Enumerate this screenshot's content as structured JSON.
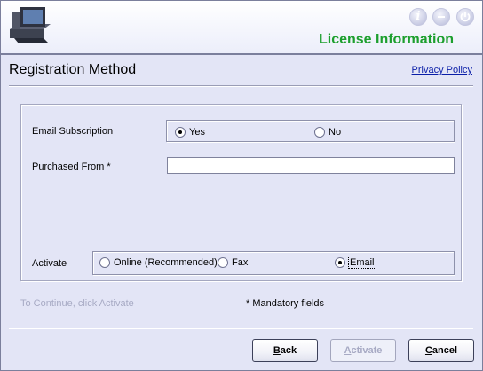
{
  "header": {
    "app_title": "License Information",
    "window_controls": [
      "info-icon",
      "minimize-icon",
      "power-icon"
    ],
    "info_glyph": "i"
  },
  "page": {
    "title": "Registration Method",
    "privacy_link": "Privacy Policy"
  },
  "form": {
    "email_subscription": {
      "label": "Email Subscription",
      "options": [
        {
          "label": "Yes",
          "checked": true
        },
        {
          "label": "No",
          "checked": false
        }
      ]
    },
    "purchased_from": {
      "label": "Purchased From *",
      "value": "",
      "placeholder": ""
    },
    "activate": {
      "label": "Activate",
      "options": [
        {
          "label": "Online (Recommended)",
          "checked": false
        },
        {
          "label": "Fax",
          "checked": false
        },
        {
          "label": "Email",
          "checked": true
        }
      ]
    }
  },
  "footer": {
    "hint": "To Continue, click Activate",
    "mandatory_note": "* Mandatory fields",
    "buttons": {
      "back": {
        "mnemonic": "B",
        "rest": "ack"
      },
      "activate": {
        "mnemonic": "A",
        "rest": "ctivate"
      },
      "cancel": {
        "mnemonic": "C",
        "rest": "ancel"
      }
    }
  },
  "colors": {
    "background": "#e3e5f6",
    "title_green": "#1d9f2e",
    "link_blue": "#0a1ea8",
    "disabled_text": "#a7aac4"
  }
}
